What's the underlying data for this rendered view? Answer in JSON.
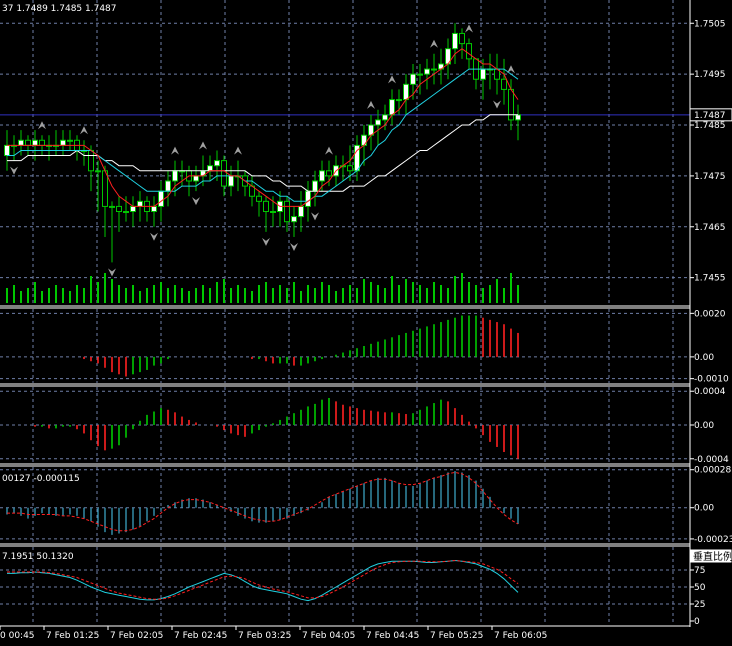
{
  "colors": {
    "background": "#000000",
    "grid": "#6f7fa8",
    "axis": "#ffffff",
    "candle_up": "#00c800",
    "candle_body_up": "#ffffff",
    "candle_body_down": "#000000",
    "ma_fast": "#ff2020",
    "ma_mid": "#20d0e0",
    "ma_slow": "#ffffff",
    "volume": "#00c800",
    "hist_up": "#00c800",
    "hist_down": "#ff2020",
    "macd_hist": "#3aa0c0",
    "signal": "#ff2020",
    "fractal": "#a0a0a0",
    "bid_line": "#3030c0"
  },
  "price_pane": {
    "header": "37 1.7489 1.7485 1.7487",
    "bid_label": "1.7487",
    "y_labels": [
      "1.7505",
      "1.7495",
      "1.7485",
      "1.7475",
      "1.7465",
      "1.7455"
    ]
  },
  "pane2": {
    "y_labels": [
      "0.0020",
      "0.00",
      "-0.0010"
    ]
  },
  "pane3": {
    "y_labels": [
      "0.0004",
      "0.00",
      "-0.0004"
    ]
  },
  "pane4": {
    "header": "00127 -0.000115",
    "y_labels": [
      "0.00028",
      "0.00",
      "-0.00023"
    ]
  },
  "pane5": {
    "header": "7.1951 50.1320",
    "y_labels": [
      "75",
      "50",
      "25",
      "0"
    ],
    "corner_text": "垂直比例"
  },
  "time_axis": {
    "labels": [
      "0 00:45",
      "7 Feb 01:25",
      "7 Feb 02:05",
      "7 Feb 02:45",
      "7 Feb 03:25",
      "7 Feb 04:05",
      "7 Feb 04:45",
      "7 Feb 05:25",
      "7 Feb 06:05"
    ]
  },
  "chart_data": [
    {
      "type": "candlestick",
      "pane": "price",
      "ylim": [
        1.7451,
        1.7508
      ],
      "bars_open": [
        1.7479,
        1.7481,
        1.7481,
        1.7482,
        1.7481,
        1.7482,
        1.7481,
        1.7481,
        1.7481,
        1.7482,
        1.7482,
        1.748,
        1.748,
        1.7476,
        1.7476,
        1.7469,
        1.7469,
        1.7468,
        1.7468,
        1.7469,
        1.747,
        1.7468,
        1.7469,
        1.7472,
        1.7474,
        1.7476,
        1.7476,
        1.7474,
        1.7475,
        1.7476,
        1.7477,
        1.7478,
        1.7473,
        1.7475,
        1.7475,
        1.7473,
        1.7471,
        1.747,
        1.7468,
        1.7468,
        1.747,
        1.7466,
        1.7467,
        1.7469,
        1.7472,
        1.7474,
        1.7476,
        1.7475,
        1.7477,
        1.7477,
        1.7476,
        1.7481,
        1.7483,
        1.7485,
        1.7486,
        1.7487,
        1.749,
        1.749,
        1.7493,
        1.7495,
        1.7495,
        1.7496,
        1.7496,
        1.7497,
        1.75,
        1.7503,
        1.7501,
        1.7498,
        1.7494,
        1.7496,
        1.7496,
        1.7494,
        1.7492,
        1.7486
      ],
      "bars_close": [
        1.7481,
        1.7481,
        1.7482,
        1.7481,
        1.7482,
        1.7481,
        1.7481,
        1.7481,
        1.7482,
        1.7482,
        1.748,
        1.748,
        1.7476,
        1.7476,
        1.7469,
        1.7469,
        1.7468,
        1.7468,
        1.7469,
        1.747,
        1.7468,
        1.7469,
        1.7472,
        1.7474,
        1.7476,
        1.7476,
        1.7474,
        1.7475,
        1.7476,
        1.7477,
        1.7478,
        1.7473,
        1.7475,
        1.7475,
        1.7473,
        1.7471,
        1.747,
        1.7468,
        1.7468,
        1.747,
        1.7466,
        1.7467,
        1.7469,
        1.7472,
        1.7474,
        1.7476,
        1.7475,
        1.7477,
        1.7477,
        1.7476,
        1.7481,
        1.7483,
        1.7485,
        1.7486,
        1.7487,
        1.749,
        1.749,
        1.7493,
        1.7495,
        1.7495,
        1.7496,
        1.7496,
        1.7497,
        1.75,
        1.7503,
        1.7501,
        1.7498,
        1.7494,
        1.7496,
        1.7496,
        1.7494,
        1.7492,
        1.7486,
        1.7487
      ],
      "bars_high": [
        1.7484,
        1.7483,
        1.7484,
        1.7483,
        1.7484,
        1.7483,
        1.7483,
        1.7484,
        1.7484,
        1.7484,
        1.7483,
        1.7482,
        1.7481,
        1.7478,
        1.7477,
        1.747,
        1.7471,
        1.7471,
        1.7471,
        1.7472,
        1.7471,
        1.7471,
        1.7474,
        1.7476,
        1.7478,
        1.7478,
        1.7477,
        1.7477,
        1.7479,
        1.7479,
        1.748,
        1.7479,
        1.7477,
        1.7478,
        1.7476,
        1.7475,
        1.7472,
        1.7471,
        1.7471,
        1.7472,
        1.7471,
        1.7469,
        1.7472,
        1.7474,
        1.7476,
        1.7478,
        1.7478,
        1.7479,
        1.7479,
        1.7481,
        1.7483,
        1.7485,
        1.7487,
        1.7488,
        1.7489,
        1.7492,
        1.7492,
        1.7495,
        1.7497,
        1.7497,
        1.7498,
        1.7499,
        1.75,
        1.7502,
        1.7505,
        1.7504,
        1.7502,
        1.7497,
        1.7498,
        1.7499,
        1.7499,
        1.7498,
        1.7494,
        1.7489
      ],
      "bars_low": [
        1.7476,
        1.7478,
        1.7479,
        1.7479,
        1.7478,
        1.7479,
        1.7478,
        1.7479,
        1.7479,
        1.748,
        1.7478,
        1.7477,
        1.7472,
        1.7468,
        1.7463,
        1.7458,
        1.7464,
        1.7466,
        1.7465,
        1.7466,
        1.7466,
        1.7465,
        1.7466,
        1.7469,
        1.7471,
        1.7473,
        1.7471,
        1.7472,
        1.7473,
        1.7474,
        1.7474,
        1.7471,
        1.7471,
        1.7472,
        1.7471,
        1.7469,
        1.7467,
        1.7464,
        1.7465,
        1.7465,
        1.7464,
        1.7463,
        1.7464,
        1.7466,
        1.7469,
        1.7472,
        1.7473,
        1.7473,
        1.7474,
        1.7474,
        1.7474,
        1.7477,
        1.748,
        1.7481,
        1.7484,
        1.7485,
        1.7487,
        1.7487,
        1.749,
        1.7491,
        1.7492,
        1.7493,
        1.7493,
        1.7494,
        1.7497,
        1.7498,
        1.7496,
        1.7492,
        1.749,
        1.7492,
        1.7491,
        1.7489,
        1.7484,
        1.7482
      ],
      "ma_fast": [
        1.7481,
        1.7481,
        1.7481,
        1.7481,
        1.7481,
        1.7481,
        1.7481,
        1.7481,
        1.7481,
        1.7481,
        1.7481,
        1.7481,
        1.748,
        1.7479,
        1.7476,
        1.7473,
        1.7471,
        1.747,
        1.7469,
        1.7469,
        1.7469,
        1.7469,
        1.747,
        1.7471,
        1.7473,
        1.7474,
        1.7475,
        1.7475,
        1.7475,
        1.7476,
        1.7476,
        1.7476,
        1.7475,
        1.7475,
        1.7474,
        1.7473,
        1.7472,
        1.7471,
        1.747,
        1.7469,
        1.7469,
        1.7469,
        1.7469,
        1.747,
        1.7471,
        1.7473,
        1.7474,
        1.7476,
        1.7477,
        1.7478,
        1.748,
        1.7481,
        1.7483,
        1.7484,
        1.7485,
        1.7487,
        1.7488,
        1.749,
        1.7491,
        1.7493,
        1.7494,
        1.7495,
        1.7496,
        1.7497,
        1.7499,
        1.75,
        1.7499,
        1.7498,
        1.7497,
        1.7497,
        1.7496,
        1.7495,
        1.7492,
        1.749
      ],
      "ma_mid": [
        1.7479,
        1.7479,
        1.748,
        1.748,
        1.748,
        1.748,
        1.748,
        1.748,
        1.748,
        1.748,
        1.748,
        1.748,
        1.748,
        1.7479,
        1.7478,
        1.7477,
        1.7476,
        1.7475,
        1.7474,
        1.7473,
        1.7472,
        1.7472,
        1.7472,
        1.7472,
        1.7472,
        1.7473,
        1.7473,
        1.7473,
        1.7474,
        1.7474,
        1.7475,
        1.7475,
        1.7475,
        1.7475,
        1.7474,
        1.7474,
        1.7473,
        1.7472,
        1.7472,
        1.7471,
        1.7471,
        1.747,
        1.747,
        1.747,
        1.7471,
        1.7471,
        1.7472,
        1.7473,
        1.7474,
        1.7475,
        1.7476,
        1.7478,
        1.7479,
        1.7481,
        1.7482,
        1.7484,
        1.7485,
        1.7487,
        1.7488,
        1.7489,
        1.749,
        1.7491,
        1.7492,
        1.7493,
        1.7494,
        1.7495,
        1.7496,
        1.7496,
        1.7496,
        1.7496,
        1.7496,
        1.7496,
        1.7495,
        1.7494
      ],
      "ma_slow": [
        1.7478,
        1.7478,
        1.7478,
        1.7479,
        1.7479,
        1.7479,
        1.7479,
        1.7479,
        1.7479,
        1.7479,
        1.748,
        1.7479,
        1.7479,
        1.7479,
        1.7478,
        1.7478,
        1.7477,
        1.7477,
        1.7477,
        1.7476,
        1.7476,
        1.7476,
        1.7476,
        1.7476,
        1.7476,
        1.7476,
        1.7476,
        1.7476,
        1.7476,
        1.7476,
        1.7476,
        1.7476,
        1.7476,
        1.7476,
        1.7476,
        1.7475,
        1.7475,
        1.7475,
        1.7474,
        1.7474,
        1.7473,
        1.7473,
        1.7473,
        1.7472,
        1.7472,
        1.7472,
        1.7472,
        1.7472,
        1.7472,
        1.7473,
        1.7473,
        1.7473,
        1.7474,
        1.7475,
        1.7475,
        1.7476,
        1.7477,
        1.7478,
        1.7479,
        1.748,
        1.748,
        1.7481,
        1.7482,
        1.7483,
        1.7484,
        1.7485,
        1.7485,
        1.7486,
        1.7486,
        1.7487,
        1.7487,
        1.7487,
        1.7487,
        1.7487
      ],
      "volume": [
        0.5,
        0.6,
        0.4,
        0.5,
        0.7,
        0.4,
        0.5,
        0.6,
        0.5,
        0.4,
        0.6,
        0.5,
        0.9,
        0.7,
        1.0,
        0.8,
        0.6,
        0.5,
        0.6,
        0.4,
        0.5,
        0.6,
        0.7,
        0.5,
        0.6,
        0.5,
        0.4,
        0.5,
        0.6,
        0.5,
        0.7,
        0.8,
        0.5,
        0.6,
        0.5,
        0.4,
        0.6,
        0.7,
        0.5,
        0.6,
        0.5,
        0.7,
        0.4,
        0.6,
        0.5,
        0.7,
        0.6,
        0.4,
        0.5,
        0.6,
        0.5,
        0.8,
        0.7,
        0.6,
        0.5,
        0.9,
        0.6,
        0.8,
        0.7,
        0.6,
        0.5,
        0.7,
        0.6,
        0.5,
        0.9,
        1.0,
        0.7,
        0.6,
        0.5,
        0.6,
        0.8,
        0.5,
        1.0,
        0.6
      ],
      "fractals_up": [
        5,
        11,
        24,
        28,
        33,
        46,
        52,
        55,
        61,
        66,
        72
      ],
      "fractals_down": [
        1,
        15,
        21,
        27,
        37,
        41,
        44,
        70
      ]
    },
    {
      "type": "histogram",
      "pane": "oscillator-1",
      "ylim": [
        -0.0012,
        0.0022
      ],
      "values": [
        0.0,
        0.0,
        0.0,
        0.0,
        0.0,
        0.0,
        0.0,
        0.0,
        0.0,
        0.0,
        0.0,
        -0.0001,
        -0.0002,
        -0.0003,
        -0.0005,
        -0.0007,
        -0.0008,
        -0.0009,
        -0.0008,
        -0.0007,
        -0.0006,
        -0.0004,
        -0.0003,
        -0.0001,
        0.0,
        0.0,
        0.0,
        0.0,
        0.0,
        0.0,
        0.0,
        0.0,
        0.0,
        0.0,
        0.0,
        -0.0001,
        -0.0001,
        -0.0002,
        -0.0003,
        -0.0003,
        -0.0003,
        -0.0004,
        -0.0004,
        -0.0003,
        -0.0002,
        -0.0001,
        0.0,
        0.0001,
        0.0002,
        0.0003,
        0.0004,
        0.0005,
        0.0006,
        0.0007,
        0.0008,
        0.0009,
        0.001,
        0.0011,
        0.0012,
        0.0013,
        0.0014,
        0.0015,
        0.0016,
        0.0017,
        0.0018,
        0.0019,
        0.0019,
        0.0019,
        0.0018,
        0.0017,
        0.0016,
        0.0015,
        0.0013,
        0.0011
      ]
    },
    {
      "type": "histogram",
      "pane": "oscillator-2",
      "ylim": [
        -0.00045,
        0.00045
      ],
      "values": [
        0.0,
        0.0,
        0.0,
        0.0,
        -2e-05,
        -2e-05,
        -4e-05,
        -4e-05,
        -2e-05,
        -2e-05,
        -5e-05,
        -0.0001,
        -0.00018,
        -0.00025,
        -0.0003,
        -0.00028,
        -0.00024,
        -0.00015,
        -5e-05,
        5e-05,
        0.00012,
        0.00016,
        0.0002,
        0.00018,
        0.00015,
        0.0001,
        6e-05,
        3e-05,
        0.0,
        0.0,
        -2e-05,
        -6e-05,
        -0.0001,
        -0.00012,
        -0.00014,
        -0.0001,
        -6e-05,
        -2e-05,
        2e-05,
        6e-05,
        0.0001,
        0.00014,
        0.00018,
        0.00022,
        0.00025,
        0.0003,
        0.00032,
        0.00028,
        0.00024,
        0.00022,
        0.0002,
        0.00018,
        0.00017,
        0.00016,
        0.00015,
        0.00015,
        0.00014,
        0.00013,
        0.00014,
        0.00018,
        0.00022,
        0.00026,
        0.0003,
        0.00028,
        0.0002,
        0.00012,
        4e-05,
        -4e-05,
        -0.00012,
        -0.0002,
        -0.00026,
        -0.00032,
        -0.00036,
        -0.0004
      ]
    },
    {
      "type": "macd",
      "pane": "oscillator-3",
      "ylim": [
        -0.00026,
        0.0003
      ],
      "histogram": [
        -5e-05,
        -4e-05,
        -6e-05,
        -8e-05,
        -6e-05,
        -4e-05,
        -5e-05,
        -6e-05,
        -6e-05,
        -5e-05,
        -6e-05,
        -8e-05,
        -0.0001,
        -0.00014,
        -0.00018,
        -0.0002,
        -0.00019,
        -0.00018,
        -0.00016,
        -0.00014,
        -0.0001,
        -6e-05,
        -2e-05,
        2e-05,
        4e-05,
        6e-05,
        7e-05,
        7e-05,
        6e-05,
        4e-05,
        2e-05,
        0.0,
        -3e-05,
        -6e-05,
        -8e-05,
        -0.0001,
        -0.00011,
        -0.00011,
        -0.0001,
        -9e-05,
        -8e-05,
        -6e-05,
        -4e-05,
        -2e-05,
        0.0,
        4e-05,
        8e-05,
        0.0001,
        0.00012,
        0.00014,
        0.00016,
        0.00018,
        0.0002,
        0.00022,
        0.00022,
        0.0002,
        0.00018,
        0.00016,
        0.00016,
        0.00018,
        0.0002,
        0.00022,
        0.00024,
        0.00026,
        0.00027,
        0.00026,
        0.00024,
        0.0002,
        0.00014,
        8e-05,
        0.0,
        -4e-05,
        -8e-05,
        -0.00012
      ],
      "signal": [
        -4e-05,
        -4e-05,
        -4e-05,
        -5e-05,
        -5e-05,
        -5e-05,
        -5e-05,
        -5e-05,
        -6e-05,
        -6e-05,
        -7e-05,
        -8e-05,
        -0.0001,
        -0.00012,
        -0.00014,
        -0.00016,
        -0.00017,
        -0.00017,
        -0.00016,
        -0.00014,
        -0.00011,
        -8e-05,
        -4e-05,
        0.0,
        3e-05,
        5e-05,
        6e-05,
        6e-05,
        5e-05,
        4e-05,
        2e-05,
        0.0,
        -2e-05,
        -4e-05,
        -6e-05,
        -8e-05,
        -9e-05,
        -0.0001,
        -0.0001,
        -9e-05,
        -7e-05,
        -5e-05,
        -3e-05,
        -1e-05,
        2e-05,
        5e-05,
        8e-05,
        0.0001,
        0.00012,
        0.00014,
        0.00016,
        0.00018,
        0.0002,
        0.00021,
        0.00021,
        0.0002,
        0.00018,
        0.00017,
        0.00017,
        0.00018,
        0.0002,
        0.00022,
        0.00023,
        0.00025,
        0.00026,
        0.00025,
        0.00022,
        0.00018,
        0.00012,
        6e-05,
        0.0,
        -5e-05,
        -9e-05,
        -0.00012
      ]
    },
    {
      "type": "stochastic",
      "pane": "oscillator-4",
      "ylim": [
        0,
        100
      ],
      "main": [
        70,
        70,
        71,
        71,
        72,
        71,
        70,
        68,
        66,
        64,
        60,
        55,
        50,
        46,
        42,
        40,
        38,
        36,
        34,
        32,
        31,
        31,
        33,
        36,
        40,
        45,
        50,
        54,
        58,
        62,
        66,
        70,
        68,
        64,
        58,
        52,
        48,
        46,
        44,
        42,
        40,
        36,
        32,
        30,
        33,
        38,
        44,
        50,
        56,
        62,
        68,
        74,
        80,
        84,
        86,
        88,
        88,
        88,
        88,
        87,
        86,
        86,
        87,
        88,
        89,
        88,
        86,
        84,
        80,
        76,
        70,
        62,
        52,
        42
      ],
      "signal": [
        72,
        72,
        72,
        72,
        72,
        72,
        71,
        70,
        68,
        66,
        64,
        60,
        56,
        52,
        48,
        44,
        41,
        39,
        37,
        35,
        33,
        32,
        32,
        34,
        37,
        41,
        45,
        49,
        53,
        57,
        61,
        65,
        66,
        65,
        62,
        57,
        53,
        50,
        47,
        45,
        43,
        40,
        37,
        34,
        34,
        36,
        40,
        45,
        50,
        56,
        62,
        68,
        74,
        79,
        83,
        86,
        87,
        88,
        88,
        88,
        87,
        87,
        87,
        88,
        89,
        88,
        87,
        86,
        84,
        80,
        76,
        70,
        62,
        55
      ]
    }
  ]
}
